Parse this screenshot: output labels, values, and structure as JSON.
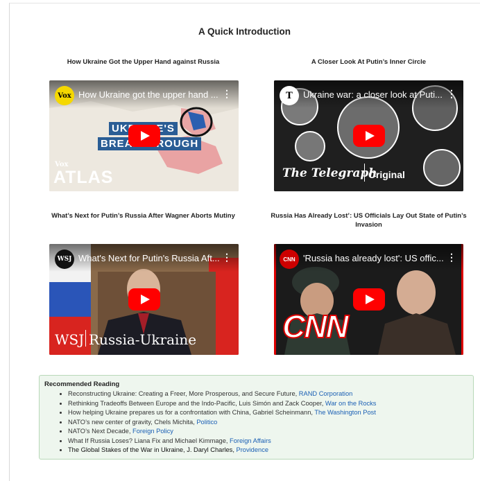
{
  "page": {
    "title": "A Quick Introduction"
  },
  "videos": [
    {
      "heading": "How Ukraine Got the Upper Hand against Russia",
      "title": "How Ukraine got the upper hand ...",
      "channel_logo": "Vox",
      "overlay_line1": "UKRAINE'S",
      "overlay_line2": "BREAKTHROUGH",
      "corner_brand_small": "Vox",
      "corner_brand": "ATLAS"
    },
    {
      "heading": "A Closer Look At Putin’s Inner Circle",
      "title": "Ukraine war: a closer look at Puti...",
      "channel_logo": "T",
      "overlay_line1": "The Telegraph",
      "overlay_line2": "Original"
    },
    {
      "heading": "What’s Next for Putin’s Russia After Wagner Aborts Mutiny",
      "title": "What's Next for Putin's Russia Aft...",
      "channel_logo": "WSJ",
      "overlay_line1": "WSJ",
      "overlay_line2": "Russia-Ukraine"
    },
    {
      "heading": "Russia Has Already Lost’: US Officials Lay Out State of Putin’s Invasion",
      "title": "'Russia has already lost': US offic...",
      "channel_logo": "CNN",
      "overlay_line1": "CNN"
    }
  ],
  "reading": {
    "heading": "Recommended Reading",
    "items": [
      {
        "text": "Reconstructing Ukraine: Creating a Freer, More Prosperous, and Secure Future, ",
        "link": "RAND Corporation"
      },
      {
        "text": "Rethinking Tradeoffs Between Europe and the Indo-Pacific, Luis Simón and Zack Cooper, ",
        "link": "War on the Rocks"
      },
      {
        "text": "How helping Ukraine prepares us for a confrontation with China, Gabriel Scheinmann, ",
        "link": "The Washington Post"
      },
      {
        "text": "NATO’s new center of gravity, Chels Michita, ",
        "link": "Politico"
      },
      {
        "text": "NATO’s Next Decade, ",
        "link": "Foreign Policy"
      },
      {
        "text": "What If Russia Loses? Liana Fix and Michael Kimmage, ",
        "link": "Foreign Affairs"
      },
      {
        "text": "The Global Stakes of the War in Ukraine, J. Daryl Charles, ",
        "link": "Providence"
      }
    ]
  },
  "colors": {
    "link": "#1a5fb4",
    "play": "#ff0000",
    "reading_bg": "#eef6ee",
    "reading_border": "#b8d8b8"
  }
}
